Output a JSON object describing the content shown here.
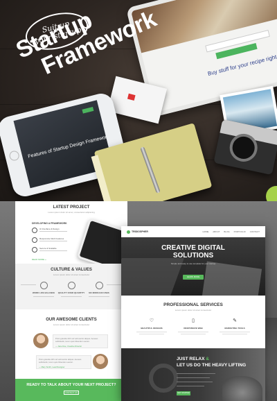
{
  "hero": {
    "badge_line1": "Suit up",
    "badge_line2": "your startup",
    "title_line1": "Startup",
    "title_line2": "Framework",
    "tablet_tagline": "Buy stuff for your recipe right from the app",
    "phone_text": "Features of Startup Design Framework"
  },
  "page_left": {
    "latest_title": "LATEST PROJECT",
    "latest_sub": "Lorem ipsum dolor sit amet, consectetur adipiscing",
    "project_heading": "DEVELOPING A FRAMEWORK",
    "features": [
      {
        "label": "UI Interface & Design"
      },
      {
        "label": "Responsive Web Features"
      },
      {
        "label": "Secure & Scalable"
      }
    ],
    "read_more": "READ MORE »",
    "culture_title": "CULTURE & VALUES",
    "culture_sub": "Lorem ipsum dolor sit amet consectetur",
    "culture_items": [
      {
        "label": "WORK LIFE BALANCE"
      },
      {
        "label": "QUALITY OVER QUANTITY"
      },
      {
        "label": "NO MORE EXCUSES"
      }
    ],
    "clients_title": "OUR AWESOME CLIENTS",
    "clients_sub": "Lorem ipsum dolor sit amet consectetur",
    "quote1": "Proin gravida nibh vel velit auctor aliquet. Aenean sollicitudin, lorem quis bibendum auctor.",
    "quote1_author": "— Jane Doe, Creative Director",
    "quote2": "Proin gravida nibh vel velit auctor aliquet. Aenean sollicitudin, lorem quis bibendum auctor.",
    "quote2_author": "— Mary Smith, Lead Designer",
    "cta_title": "READY TO TALK ABOUT YOUR NEXT PROJECT?",
    "cta_button": "CONTACT US"
  },
  "page_right": {
    "brand": "TRIDIOSPHER",
    "nav": [
      "HOME",
      "ABOUT",
      "BLOG",
      "PORTFOLIO",
      "CONTACT"
    ],
    "hero_line1": "CREATIVE DIGITAL",
    "hero_line2": "SOLUTIONS",
    "hero_sub": "Simple and easy to use template for your startup",
    "hero_button": "LEARN MORE",
    "services_title": "PROFESSIONAL SERVICES",
    "services_sub": "Lorem ipsum dolor sit amet consectetur",
    "services": [
      {
        "label": "BEAUTIFUL DESIGNS",
        "icon": "heart-icon"
      },
      {
        "label": "RESPONSIVE WEB",
        "icon": "tablet-icon"
      },
      {
        "label": "MARKETING TOOLS",
        "icon": "pencil-icon"
      }
    ],
    "relax_line1a": "JUST RELAX",
    "relax_line1b": " &",
    "relax_line2": "LET US DO THE HEAVY LIFTING",
    "relax_button": "GET STARTED"
  },
  "colors": {
    "accent": "#58b95c"
  }
}
